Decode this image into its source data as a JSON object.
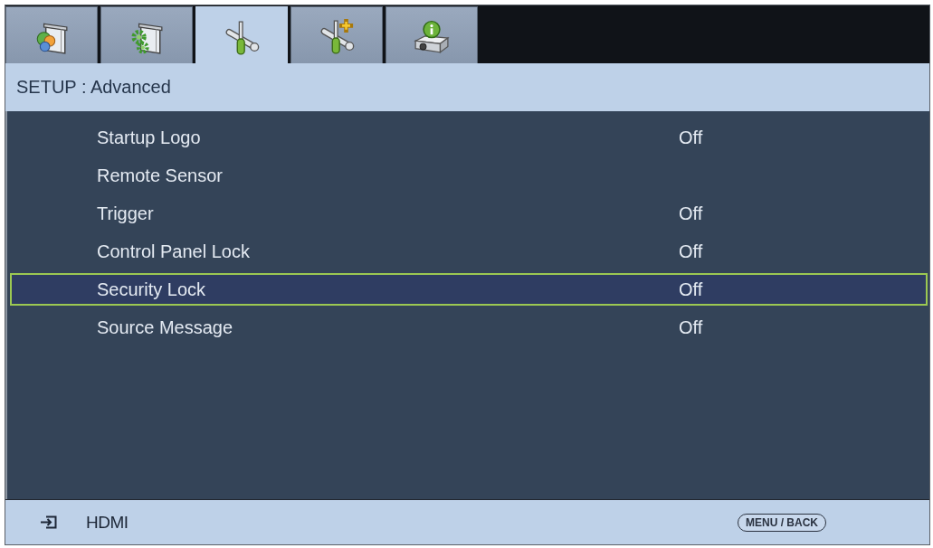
{
  "tabs": [
    {
      "kind": "palette",
      "selected": false
    },
    {
      "kind": "gear",
      "selected": false
    },
    {
      "kind": "tools",
      "selected": true
    },
    {
      "kind": "toolsplus",
      "selected": false
    },
    {
      "kind": "projector",
      "selected": false
    }
  ],
  "title": "SETUP : Advanced",
  "items": [
    {
      "label": "Startup Logo",
      "value": "Off",
      "selected": false
    },
    {
      "label": "Remote Sensor",
      "selected": false
    },
    {
      "label": "Trigger",
      "value": "Off",
      "selected": false
    },
    {
      "label": "Control Panel Lock",
      "value": "Off",
      "selected": false
    },
    {
      "label": "Security Lock",
      "value": "Off",
      "selected": true
    },
    {
      "label": "Source Message",
      "value": "Off",
      "selected": false
    }
  ],
  "status_bar": {
    "source": "HDMI",
    "key_hint": "MENU / BACK"
  }
}
